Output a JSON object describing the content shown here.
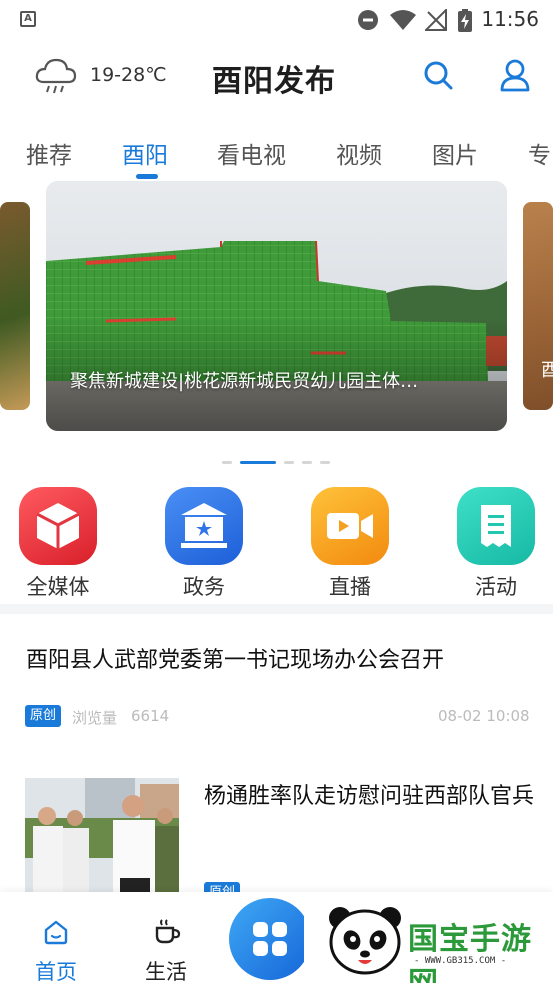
{
  "status_bar": {
    "time": "11:56",
    "left_icon": "A"
  },
  "header": {
    "temperature": "19-28℃",
    "title": "酉阳发布"
  },
  "tabs": [
    "推荐",
    "酉阳",
    "看电视",
    "视频",
    "图片",
    "专"
  ],
  "active_tab": "酉阳",
  "banner": {
    "caption": "聚焦新城建设|桃花源新城民贸幼儿园主体…",
    "right_peek_text": "酉",
    "dot_count": 5,
    "active_dot": 1
  },
  "shortcuts": [
    {
      "label": "全媒体",
      "icon": "cube-icon",
      "color": "#e8303a"
    },
    {
      "label": "政务",
      "icon": "government-building-icon",
      "color": "#2f73e8"
    },
    {
      "label": "直播",
      "icon": "video-camera-icon",
      "color": "#f7a21b"
    },
    {
      "label": "活动",
      "icon": "ticket-icon",
      "color": "#25cdb6"
    }
  ],
  "news": [
    {
      "title": "酉阳县人武部党委第一书记现场办公会召开",
      "badge": "原创",
      "views_label": "浏览量",
      "views": "6614",
      "date": "08-02 10:08"
    },
    {
      "title": "杨通胜率队走访慰问驻西部队官兵",
      "badge": "原创"
    }
  ],
  "bottom_nav": [
    {
      "label": "首页",
      "icon": "home-icon",
      "active": true
    },
    {
      "label": "生活",
      "icon": "coffee-cup-icon",
      "active": false
    }
  ],
  "watermark": {
    "text": "国宝手游网",
    "url": "- WWW.GB315.COM -"
  },
  "colors": {
    "accent": "#1a7ad9",
    "text": "#222222",
    "muted": "#bbbbbb"
  }
}
